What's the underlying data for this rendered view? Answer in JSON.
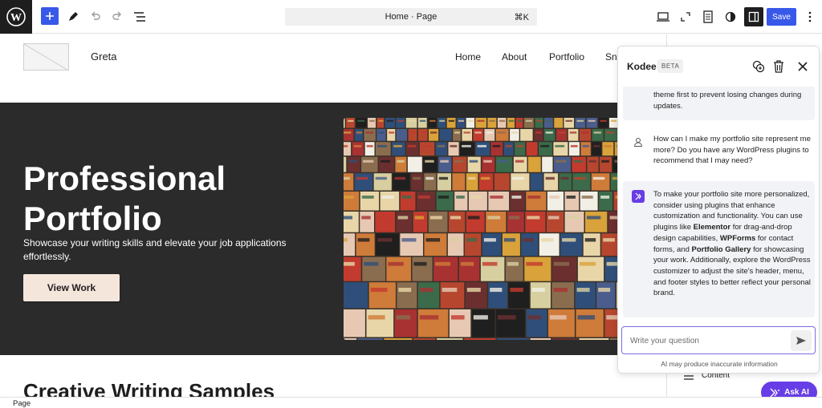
{
  "toolbar": {
    "command_bar": {
      "label": "Home · Page",
      "shortcut": "⌘K"
    },
    "save_label": "Save"
  },
  "site": {
    "title": "Greta",
    "nav": [
      "Home",
      "About",
      "Portfolio",
      "Sni"
    ]
  },
  "hero": {
    "title_line1": "Professional",
    "title_line2": "Portfolio",
    "subtitle": "Showcase your writing skills and elevate your job applications effortlessly.",
    "button_label": "View Work"
  },
  "section_title": "Creative Writing Samples",
  "sidebar": {
    "content_label": "Content"
  },
  "kodee": {
    "title": "Kodee",
    "badge": "BETA",
    "messages": [
      {
        "role": "assistant",
        "text": "theme first to prevent losing changes during updates."
      },
      {
        "role": "user",
        "text": "How can I make my portfolio site represent me more? Do you have any WordPress plugins to recommend that I may need?"
      },
      {
        "role": "assistant",
        "parts": [
          "To make your portfolio site more personalized, consider using plugins that enhance customization and functionality. You can use plugins like ",
          "Elementor",
          " for drag-and-drop design capabilities, ",
          "WPForms",
          " for contact forms, and ",
          "Portfolio Gallery",
          " for showcasing your work. Additionally, explore the WordPress customizer to adjust the site's header, menu, and footer styles to better reflect your personal brand."
        ]
      }
    ],
    "input_placeholder": "Write your question",
    "disclaimer": "AI may produce inaccurate information"
  },
  "ask_ai_label": "Ask AI",
  "footer": {
    "breadcrumb": "Page"
  },
  "colors": {
    "accent": "#3858e9",
    "kodee_purple": "#673de6",
    "hero_bg": "#2b2b2b",
    "button_bg": "#f5e6dc"
  }
}
